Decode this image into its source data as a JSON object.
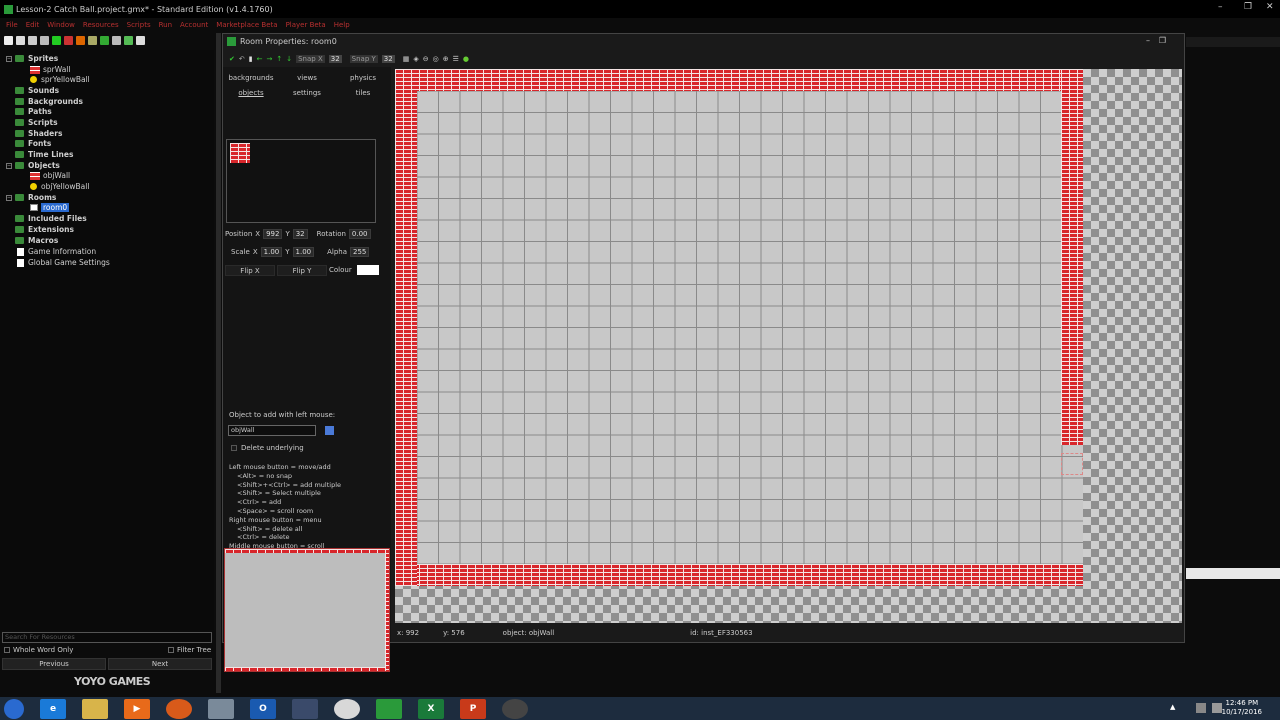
{
  "window": {
    "title": "Lesson-2 Catch Ball.project.gmx* - Standard Edition (v1.4.1760)",
    "controls": [
      "–",
      "❐",
      "✕"
    ]
  },
  "menu": [
    "File",
    "Edit",
    "Window",
    "Resources",
    "Scripts",
    "Run",
    "Account",
    "Marketplace Beta",
    "Player Beta",
    "Help"
  ],
  "tree": {
    "sprites": "Sprites",
    "spr_wall": "sprWall",
    "spr_ball": "sprYellowBall",
    "sounds": "Sounds",
    "backgrounds": "Backgrounds",
    "paths": "Paths",
    "scripts": "Scripts",
    "shaders": "Shaders",
    "fonts": "Fonts",
    "timelines": "Time Lines",
    "objects": "Objects",
    "obj_wall": "objWall",
    "obj_ball": "objYellowBall",
    "rooms": "Rooms",
    "room0": "room0",
    "included": "Included Files",
    "extensions": "Extensions",
    "macros": "Macros",
    "game_info": "Game Information",
    "global_settings": "Global Game Settings"
  },
  "search": {
    "placeholder": "Search For Resources",
    "whole_word": "Whole Word Only",
    "filter_tree": "Filter Tree",
    "previous": "Previous",
    "next": "Next"
  },
  "logo": "YOYO GAMES",
  "room_window": {
    "title": "Room Properties: room0",
    "snap_x_label": "Snap X",
    "snap_x": "32",
    "snap_y_label": "Snap Y",
    "snap_y": "32",
    "tabs_row1": [
      "backgrounds",
      "views",
      "physics"
    ],
    "tabs_row2": [
      "objects",
      "settings",
      "tiles"
    ],
    "position_label": "Position",
    "x_label": "X",
    "x_value": "992",
    "y_label": "Y",
    "y_value": "32",
    "rotation_label": "Rotation",
    "rotation_value": "0.00",
    "scale_label": "Scale",
    "scale_x": "1.00",
    "scale_y": "1.00",
    "alpha_label": "Alpha",
    "alpha_value": "255",
    "flip_x": "Flip X",
    "flip_y": "Flip Y",
    "colour_label": "Colour",
    "colour_value": "#ffffff",
    "add_object_label": "Object to add with left mouse:",
    "selected_object": "objWall",
    "delete_underlying": "Delete underlying",
    "help_lines": [
      "Left mouse button = move/add",
      "<Alt> = no snap",
      "<Shift>+<Ctrl> = add multiple",
      "<Shift> = Select multiple",
      "<Ctrl> = add",
      "<Space> = scroll room",
      "Right mouse button = menu",
      "<Shift> = delete all",
      "<Ctrl> = delete",
      "Middle mouse button = scroll"
    ]
  },
  "status": {
    "x": "x: 992",
    "y": "y: 576",
    "object": "object: objWall",
    "id": "id: inst_EF330563"
  },
  "clock": {
    "time": "12:46 PM",
    "date": "10/17/2016"
  },
  "colors": {
    "wall": "#d8262b",
    "room_bg": "#c8c8c8",
    "selection": "#2a6ad0",
    "taskbar": "#1d2c3e"
  }
}
